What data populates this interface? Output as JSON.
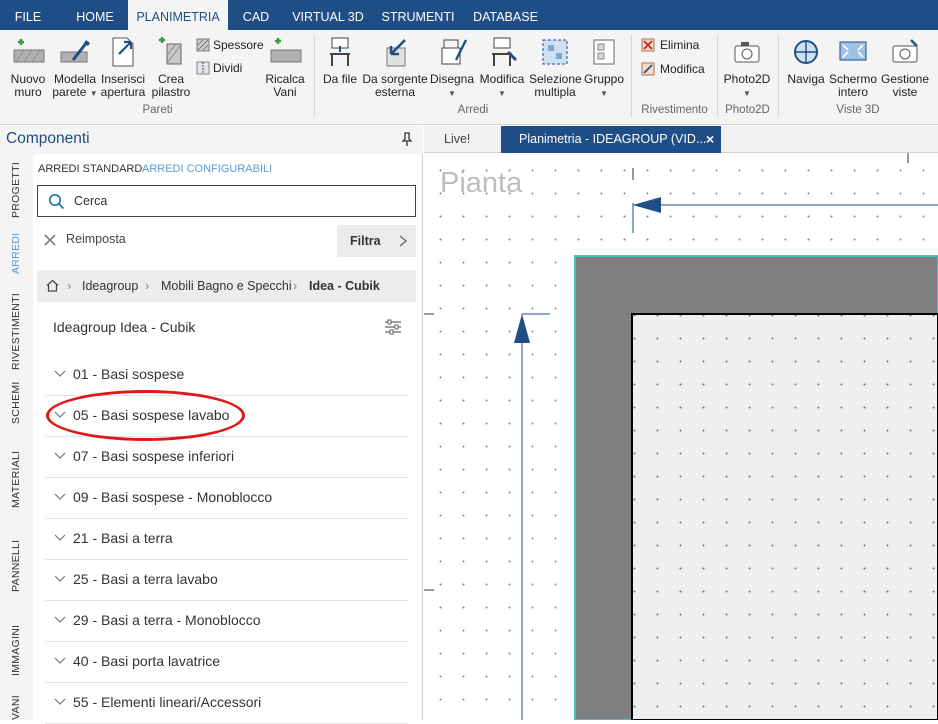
{
  "ribbon_tabs": [
    "FILE",
    "HOME",
    "PLANIMETRIA",
    "CAD",
    "VIRTUAL 3D",
    "STRUMENTI",
    "DATABASE"
  ],
  "ribbon": {
    "nuovo_muro": "Nuovo muro",
    "modella_parete": "Modella parete",
    "inserisci_apertura": "Inserisci apertura",
    "crea_pilastro": "Crea pilastro",
    "spessore": "Spessore",
    "dividi": "Dividi",
    "ricalca_vani": "Ricalca Vani",
    "group_pareti": "Pareti",
    "da_file": "Da file",
    "da_sorgente_esterna": "Da sorgente esterna",
    "disegna": "Disegna",
    "modifica": "Modifica",
    "selezione_multipla": "Selezione multipla",
    "gruppo": "Gruppo",
    "group_arredi": "Arredi",
    "elimina": "Elimina",
    "modifica_rivestimento": "Modifica",
    "group_rivestimento": "Rivestimento",
    "photo2d": "Photo2D",
    "group_photo2d": "Photo2D",
    "naviga": "Naviga",
    "schermo_intero": "Schermo intero",
    "gestione_viste": "Gestione viste",
    "group_viste3d": "Viste 3D"
  },
  "panel": {
    "title": "Componenti",
    "side_tabs": [
      "PROGETTI",
      "ARREDI",
      "RIVESTIMENTI",
      "SCHEMI",
      "MATERIALI",
      "PANNELLI",
      "IMMAGINI",
      "VANI"
    ],
    "subtab_standard": "ARREDI STANDARD",
    "subtab_configurabili": "ARREDI CONFIGURABILI",
    "search_placeholder": "Cerca",
    "reset_label": "Reimposta",
    "filter_label": "Filtra",
    "breadcrumb": [
      "Ideagroup",
      "Mobili Bagno e Specchi",
      "Idea - Cubik"
    ],
    "list_title": "Ideagroup Idea - Cubik",
    "items": [
      "01 - Basi sospese",
      "05 - Basi sospese lavabo",
      "07 - Basi sospese inferiori",
      "09 - Basi sospese - Monoblocco",
      "21 - Basi a terra",
      "25 - Basi a terra lavabo",
      "29 - Basi a terra - Monoblocco",
      "40 - Basi porta lavatrice",
      "55 - Elementi lineari/Accessori"
    ]
  },
  "doc_tabs": {
    "live": "Live!",
    "planimetria": "Planimetria - IDEAGROUP (VID...",
    "close": "×"
  },
  "canvas": {
    "view_label": "Pianta"
  },
  "colors": {
    "brand": "#1f4e86",
    "accent": "#5b9bd5",
    "highlight": "#e01818",
    "wall": "#7f7f7f"
  }
}
